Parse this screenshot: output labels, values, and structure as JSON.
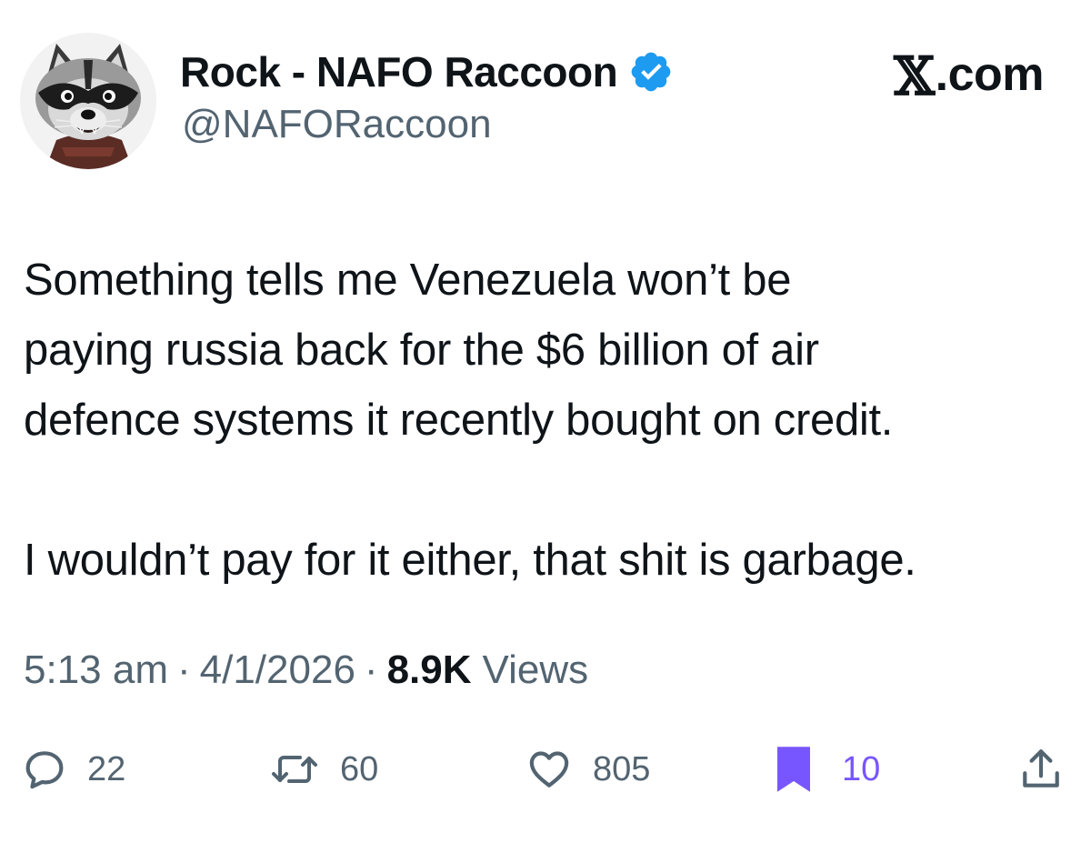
{
  "author": {
    "display_name": "Rock - NAFO Raccoon",
    "handle": "@NAFORaccoon",
    "verified": true
  },
  "site": {
    "logo_letter": "𝕏",
    "logo_suffix": ".com"
  },
  "tweet": {
    "text": "Something tells me Venezuela won’t be\npaying russia back for the $6 billion of air\ndefence systems it recently bought on credit.\n\nI wouldn’t pay for it either, that shit is garbage."
  },
  "meta": {
    "time": "5:13 am",
    "separator": "·",
    "date": "4/1/2026",
    "views_count": "8.9K",
    "views_label": "Views"
  },
  "actions": {
    "replies": "22",
    "reposts": "60",
    "likes": "805",
    "bookmarks": "10"
  },
  "colors": {
    "text": "#0f1419",
    "secondary": "#536471",
    "verified": "#1d9bf0",
    "bookmark_active": "#7856ff"
  },
  "icons": {
    "avatar": "raccoon-avatar",
    "verified": "verified-badge-icon",
    "reply": "reply-icon",
    "repost": "repost-icon",
    "like": "heart-icon",
    "bookmark": "bookmark-icon",
    "share": "share-icon"
  }
}
